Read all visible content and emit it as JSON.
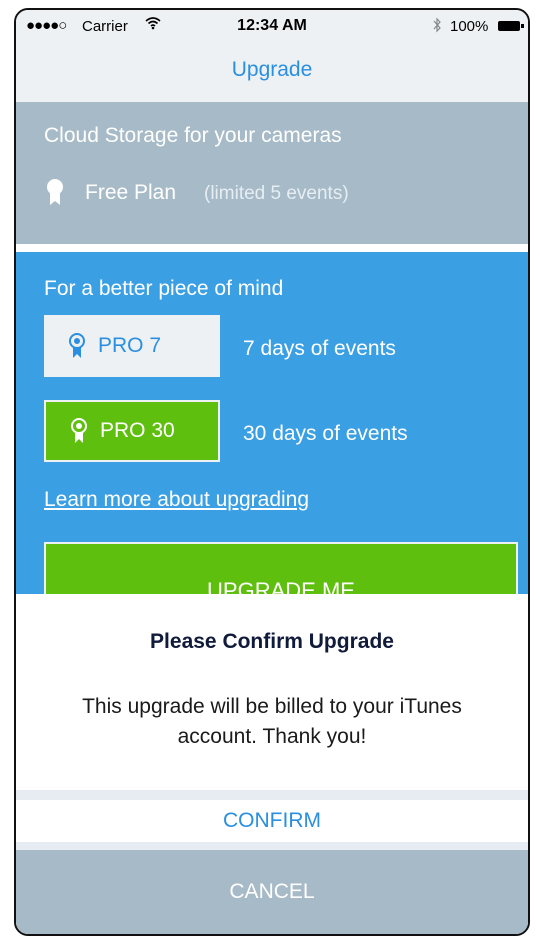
{
  "status_bar": {
    "signal": "●●●●○",
    "carrier": "Carrier",
    "wifi_icon": "wifi-icon",
    "time": "12:34 AM",
    "bluetooth_icon": "bluetooth-icon",
    "battery": "100%"
  },
  "nav": {
    "title": "Upgrade"
  },
  "free_section": {
    "heading": "Cloud Storage for your cameras",
    "plan_icon": "ribbon-icon",
    "plan_name": "Free Plan",
    "plan_note": "(limited 5 events)"
  },
  "pro_section": {
    "heading": "For a better piece of mind",
    "plans": [
      {
        "label": "PRO 7",
        "description": "7 days of events",
        "icon": "award-icon"
      },
      {
        "label": "PRO 30",
        "description": "30 days of events",
        "icon": "award-icon"
      }
    ],
    "learn_more": "Learn more about upgrading",
    "upgrade_button": "UPGRADE ME"
  },
  "confirm_sheet": {
    "title": "Please Confirm Upgrade",
    "message": "This upgrade will be billed to your iTunes account. Thank you!",
    "confirm_label": "CONFIRM",
    "cancel_label": "CANCEL"
  },
  "colors": {
    "accent_blue": "#2a8fe0",
    "section_blue": "#3b9fe3",
    "green": "#5fbf0e",
    "gray_blue": "#a7bac7",
    "light_bg": "#eef1f4"
  }
}
